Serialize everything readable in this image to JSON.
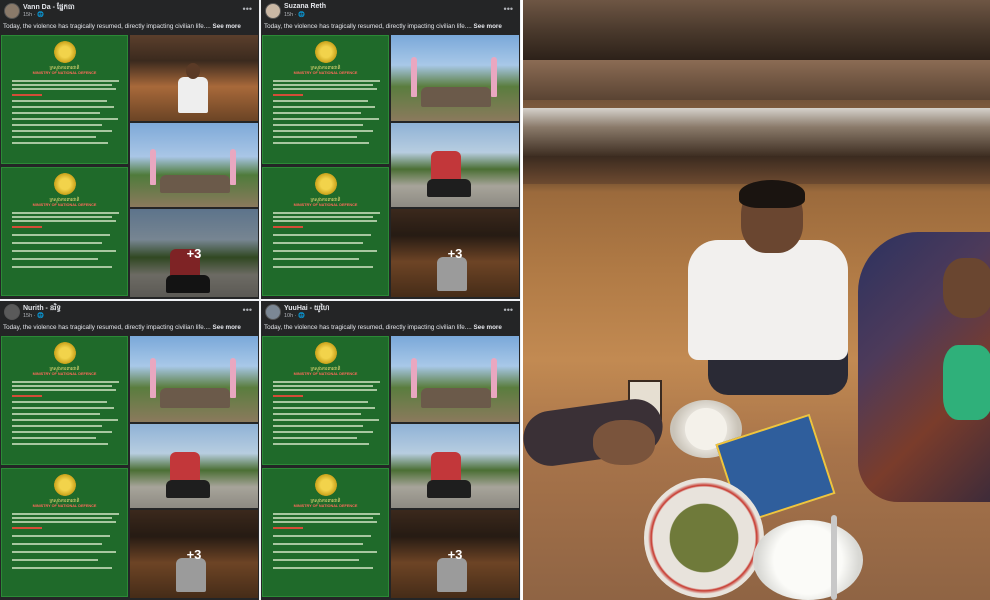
{
  "posts": [
    {
      "name": "Vann Da - ផ្នែកធា",
      "meta": "15h · 🌐",
      "text": "Today, the violence has tragically resumed, directly impacting civilian life....",
      "see_more": "See more",
      "more_count": "+3"
    },
    {
      "name": "Suzana Reth",
      "meta": "15h · 🌐",
      "text": "Today, the violence has tragically resumed, directly impacting civilian life....",
      "see_more": "See more",
      "more_count": "+3"
    },
    {
      "name": "Nurith - នរិទ្ធ",
      "meta": "15h · 🌐",
      "text": "Today, the violence has tragically resumed, directly impacting civilian life....",
      "see_more": "See more",
      "more_count": "+3"
    },
    {
      "name": "YuuHai - យូហៃ",
      "meta": "10h · 🌐",
      "text": "Today, the violence has tragically resumed, directly impacting civilian life....",
      "see_more": "See more",
      "more_count": "+3"
    }
  ],
  "document": {
    "heading": "ក្រសួងការពារជាតិ",
    "ministry": "MINISTRY OF NATIONAL DEFENCE"
  },
  "icons": {
    "menu": "more-horizontal-icon",
    "public": "globe-icon"
  },
  "colors": {
    "post_bg": "#242526",
    "doc_green": "#1f6a2a",
    "doc_red_text": "#e84a3a"
  }
}
